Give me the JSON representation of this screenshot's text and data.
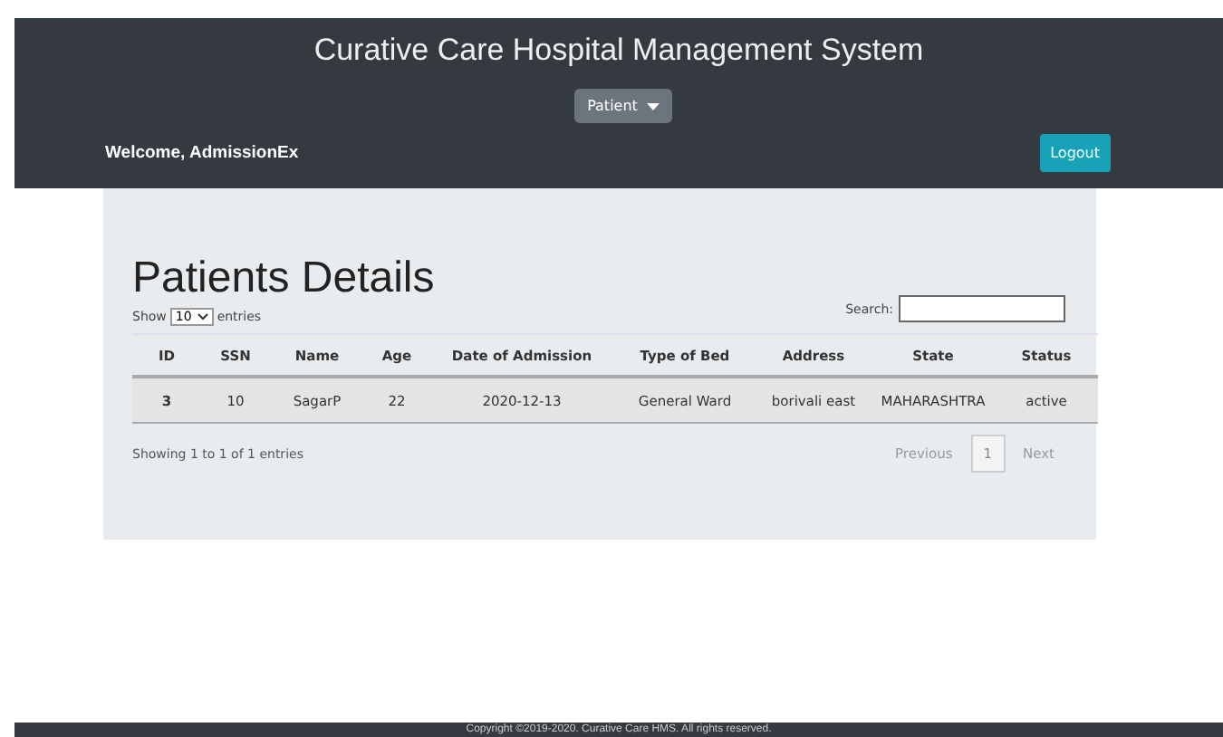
{
  "header": {
    "title": "Curative Care Hospital Management System",
    "menu": {
      "label": "Patient"
    },
    "welcome": "Welcome, AdmissionEx",
    "logout": "Logout"
  },
  "panel": {
    "heading": "Patients Details",
    "length": {
      "prefix": "Show",
      "value": "10",
      "suffix": "entries"
    },
    "search": {
      "label": "Search:"
    },
    "table": {
      "columns": [
        "ID",
        "SSN",
        "Name",
        "Age",
        "Date of Admission",
        "Type of Bed",
        "Address",
        "State",
        "Status"
      ],
      "rows": [
        [
          "3",
          "10",
          "SagarP",
          "22",
          "2020-12-13",
          "General Ward",
          "borivali east",
          "MAHARASHTRA",
          "active"
        ]
      ]
    },
    "info": "Showing 1 to 1 of 1 entries",
    "pagination": [
      {
        "label": "Previous",
        "kind": "nav",
        "disabled": true
      },
      {
        "label": "1",
        "kind": "page",
        "selected": true
      },
      {
        "label": "Next",
        "kind": "nav",
        "disabled": true
      }
    ]
  },
  "footer": "Copyright ©2019-2020. Curative Care HMS. All rights reserved."
}
